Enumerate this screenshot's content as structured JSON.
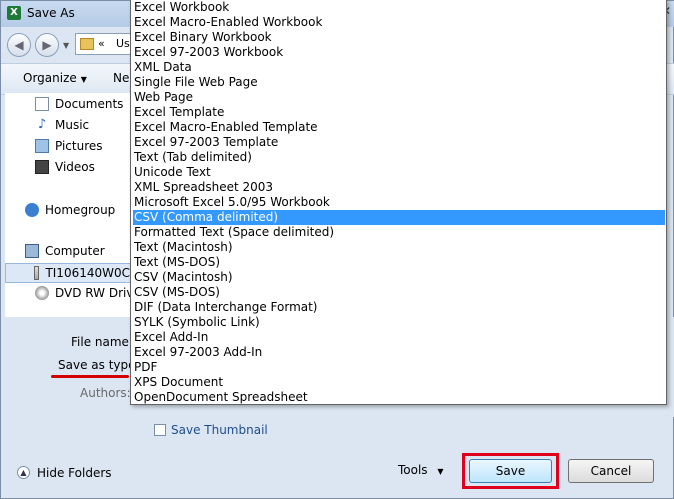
{
  "window": {
    "title": "Save As",
    "app_icon": "X"
  },
  "navbar": {
    "address_arrows": "«",
    "address_text": "Us"
  },
  "toolbar": {
    "organize": "Organize",
    "new_folder": "Ne"
  },
  "navpane": {
    "items": [
      {
        "label": "Documents",
        "icon": "documents-icon"
      },
      {
        "label": "Music",
        "icon": "music-icon"
      },
      {
        "label": "Pictures",
        "icon": "pictures-icon"
      },
      {
        "label": "Videos",
        "icon": "videos-icon"
      },
      {
        "label": "Homegroup",
        "icon": "homegroup-icon"
      },
      {
        "label": "Computer",
        "icon": "computer-icon"
      },
      {
        "label": "TI106140W0C",
        "icon": "drive-icon"
      },
      {
        "label": "DVD RW Drive",
        "icon": "dvd-icon"
      }
    ]
  },
  "form": {
    "file_name_label": "File name:",
    "save_as_type_label": "Save as type:",
    "authors_label": "Authors:",
    "save_thumbnail": "Save Thumbnail"
  },
  "footer": {
    "hide_folders": "Hide Folders",
    "tools": "Tools",
    "save": "Save",
    "cancel": "Cancel"
  },
  "dropdown": {
    "selected": "CSV (Comma delimited)",
    "options": [
      "Excel Workbook",
      "Excel Macro-Enabled Workbook",
      "Excel Binary Workbook",
      "Excel 97-2003 Workbook",
      "XML Data",
      "Single File Web Page",
      "Web Page",
      "Excel Template",
      "Excel Macro-Enabled Template",
      "Excel 97-2003 Template",
      "Text (Tab delimited)",
      "Unicode Text",
      "XML Spreadsheet 2003",
      "Microsoft Excel 5.0/95 Workbook",
      "CSV (Comma delimited)",
      "Formatted Text (Space delimited)",
      "Text (Macintosh)",
      "Text (MS-DOS)",
      "CSV (Macintosh)",
      "CSV (MS-DOS)",
      "DIF (Data Interchange Format)",
      "SYLK (Symbolic Link)",
      "Excel Add-In",
      "Excel 97-2003 Add-In",
      "PDF",
      "XPS Document",
      "OpenDocument Spreadsheet"
    ]
  },
  "colors": {
    "selection": "#3399ff",
    "annotation_red": "#e0001b"
  }
}
